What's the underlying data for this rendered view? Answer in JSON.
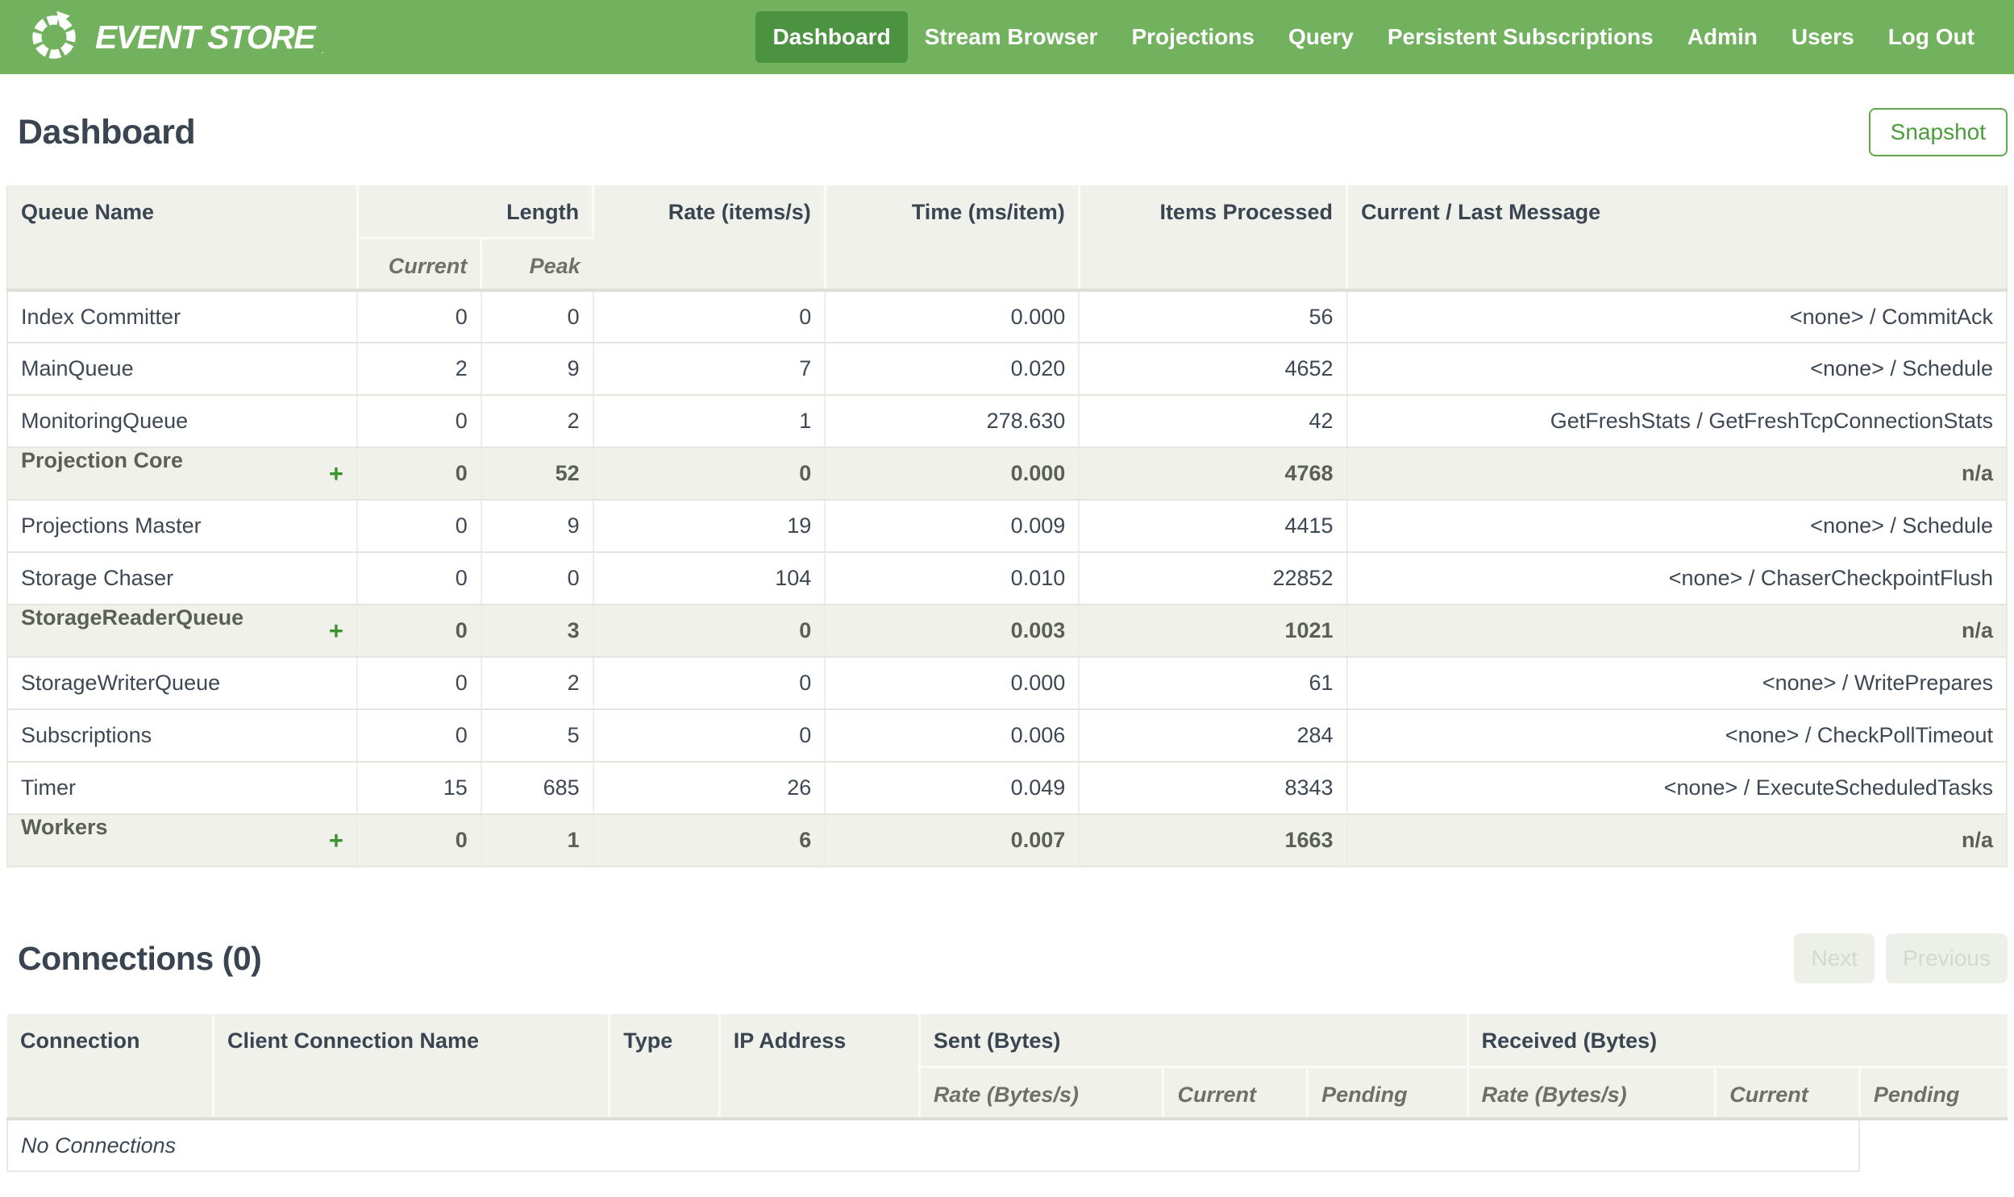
{
  "nav": {
    "brand": "EVENT STORE",
    "registered_mark": ".",
    "items": [
      {
        "label": "Dashboard",
        "active": true
      },
      {
        "label": "Stream Browser",
        "active": false
      },
      {
        "label": "Projections",
        "active": false
      },
      {
        "label": "Query",
        "active": false
      },
      {
        "label": "Persistent Subscriptions",
        "active": false
      },
      {
        "label": "Admin",
        "active": false
      },
      {
        "label": "Users",
        "active": false
      },
      {
        "label": "Log Out",
        "active": false
      }
    ]
  },
  "page": {
    "title": "Dashboard",
    "snapshot_button": "Snapshot"
  },
  "queue_table": {
    "expand_symbol": "+",
    "headers": {
      "queue_name": "Queue Name",
      "length": "Length",
      "current": "Current",
      "peak": "Peak",
      "rate": "Rate (items/s)",
      "time": "Time (ms/item)",
      "items_processed": "Items Processed",
      "message": "Current / Last Message"
    },
    "rows": [
      {
        "name": "Index Committer",
        "expandable": false,
        "current": "0",
        "peak": "0",
        "rate": "0",
        "time": "0.000",
        "items": "56",
        "message": "<none> / CommitAck"
      },
      {
        "name": "MainQueue",
        "expandable": false,
        "current": "2",
        "peak": "9",
        "rate": "7",
        "time": "0.020",
        "items": "4652",
        "message": "<none> / Schedule"
      },
      {
        "name": "MonitoringQueue",
        "expandable": false,
        "current": "0",
        "peak": "2",
        "rate": "1",
        "time": "278.630",
        "items": "42",
        "message": "GetFreshStats / GetFreshTcpConnectionStats"
      },
      {
        "name": "Projection Core",
        "expandable": true,
        "current": "0",
        "peak": "52",
        "rate": "0",
        "time": "0.000",
        "items": "4768",
        "message": "n/a"
      },
      {
        "name": "Projections Master",
        "expandable": false,
        "current": "0",
        "peak": "9",
        "rate": "19",
        "time": "0.009",
        "items": "4415",
        "message": "<none> / Schedule"
      },
      {
        "name": "Storage Chaser",
        "expandable": false,
        "current": "0",
        "peak": "0",
        "rate": "104",
        "time": "0.010",
        "items": "22852",
        "message": "<none> / ChaserCheckpointFlush"
      },
      {
        "name": "StorageReaderQueue",
        "expandable": true,
        "current": "0",
        "peak": "3",
        "rate": "0",
        "time": "0.003",
        "items": "1021",
        "message": "n/a"
      },
      {
        "name": "StorageWriterQueue",
        "expandable": false,
        "current": "0",
        "peak": "2",
        "rate": "0",
        "time": "0.000",
        "items": "61",
        "message": "<none> / WritePrepares"
      },
      {
        "name": "Subscriptions",
        "expandable": false,
        "current": "0",
        "peak": "5",
        "rate": "0",
        "time": "0.006",
        "items": "284",
        "message": "<none> / CheckPollTimeout"
      },
      {
        "name": "Timer",
        "expandable": false,
        "current": "15",
        "peak": "685",
        "rate": "26",
        "time": "0.049",
        "items": "8343",
        "message": "<none> / ExecuteScheduledTasks"
      },
      {
        "name": "Workers",
        "expandable": true,
        "current": "0",
        "peak": "1",
        "rate": "6",
        "time": "0.007",
        "items": "1663",
        "message": "n/a"
      }
    ]
  },
  "connections": {
    "title": "Connections (0)",
    "next_button": "Next",
    "previous_button": "Previous",
    "headers": {
      "connection": "Connection",
      "client_connection_name": "Client Connection Name",
      "type": "Type",
      "ip_address": "IP Address",
      "sent": "Sent (Bytes)",
      "received": "Received (Bytes)",
      "rate": "Rate (Bytes/s)",
      "current": "Current",
      "pending": "Pending"
    },
    "empty_message": "No Connections"
  },
  "colors": {
    "nav_green": "#72b15e",
    "active_item_green": "#4c9341",
    "accent_green": "#4a9c3a",
    "plus_green": "#3e9331",
    "header_bg": "#f0f1eb",
    "text_dark": "#3a4551",
    "disabled_text": "#d4d9ce"
  }
}
